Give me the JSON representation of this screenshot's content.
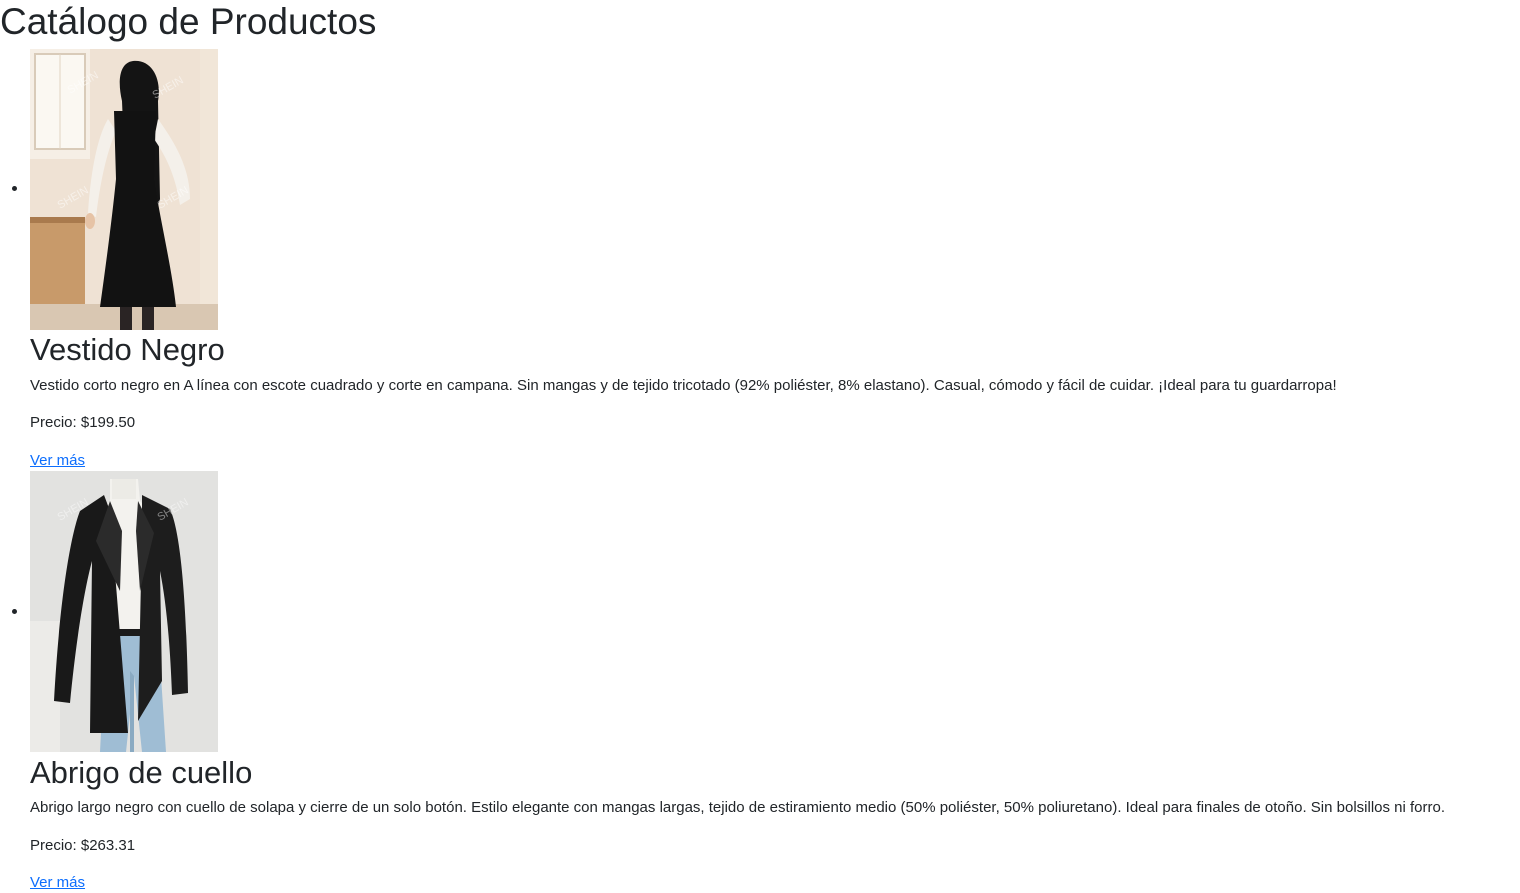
{
  "page": {
    "title": "Catálogo de Productos"
  },
  "products": [
    {
      "name": "Vestido Negro",
      "description": "Vestido corto negro en A línea con escote cuadrado y corte en campana. Sin mangas y de tejido tricotado (92% poliéster, 8% elastano). Casual, cómodo y fácil de cuidar. ¡Ideal para tu guardarropa!",
      "price": "Precio: $199.50",
      "link_label": "Ver más",
      "image_watermark": "SHEIN"
    },
    {
      "name": "Abrigo de cuello",
      "description": "Abrigo largo negro con cuello de solapa y cierre de un solo botón. Estilo elegante con mangas largas, tejido de estiramiento medio (50% poliéster, 50% poliuretano). Ideal para finales de otoño. Sin bolsillos ni forro.",
      "price": "Precio: $263.31",
      "link_label": "Ver más",
      "image_watermark": "SHEIN"
    }
  ],
  "colors": {
    "text": "#212529",
    "link": "#0d6efd"
  }
}
